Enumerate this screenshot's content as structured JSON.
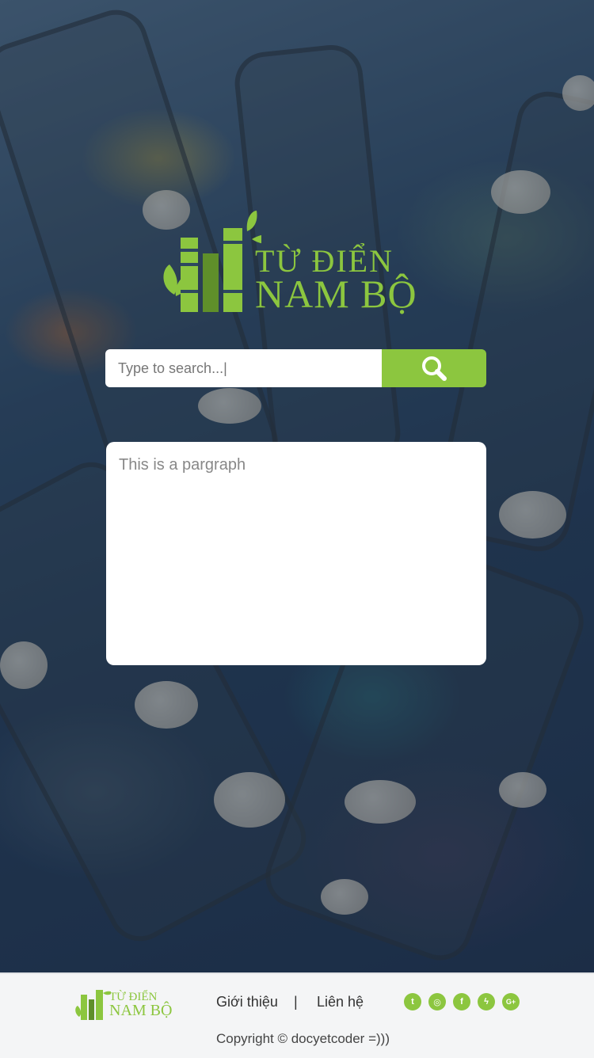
{
  "brand": {
    "line1": "TỪ ĐIỂN",
    "line2": "NAM BỘ",
    "color": "#8cc63f"
  },
  "search": {
    "placeholder": "Type to search...|",
    "button_icon": "search-icon"
  },
  "result": {
    "paragraph": "This is a pargraph"
  },
  "footer": {
    "nav": [
      {
        "label": "Giới thiệu"
      },
      {
        "separator": "|"
      },
      {
        "label": "Liên hệ"
      }
    ],
    "socials": [
      {
        "icon": "twitter-icon",
        "glyph": "t"
      },
      {
        "icon": "instagram-icon",
        "glyph": "◎"
      },
      {
        "icon": "facebook-icon",
        "glyph": "f"
      },
      {
        "icon": "messenger-icon",
        "glyph": "ϟ"
      },
      {
        "icon": "google-plus-icon",
        "glyph": "G+"
      }
    ],
    "copyright": "Copyright © docyetcoder =)))"
  }
}
